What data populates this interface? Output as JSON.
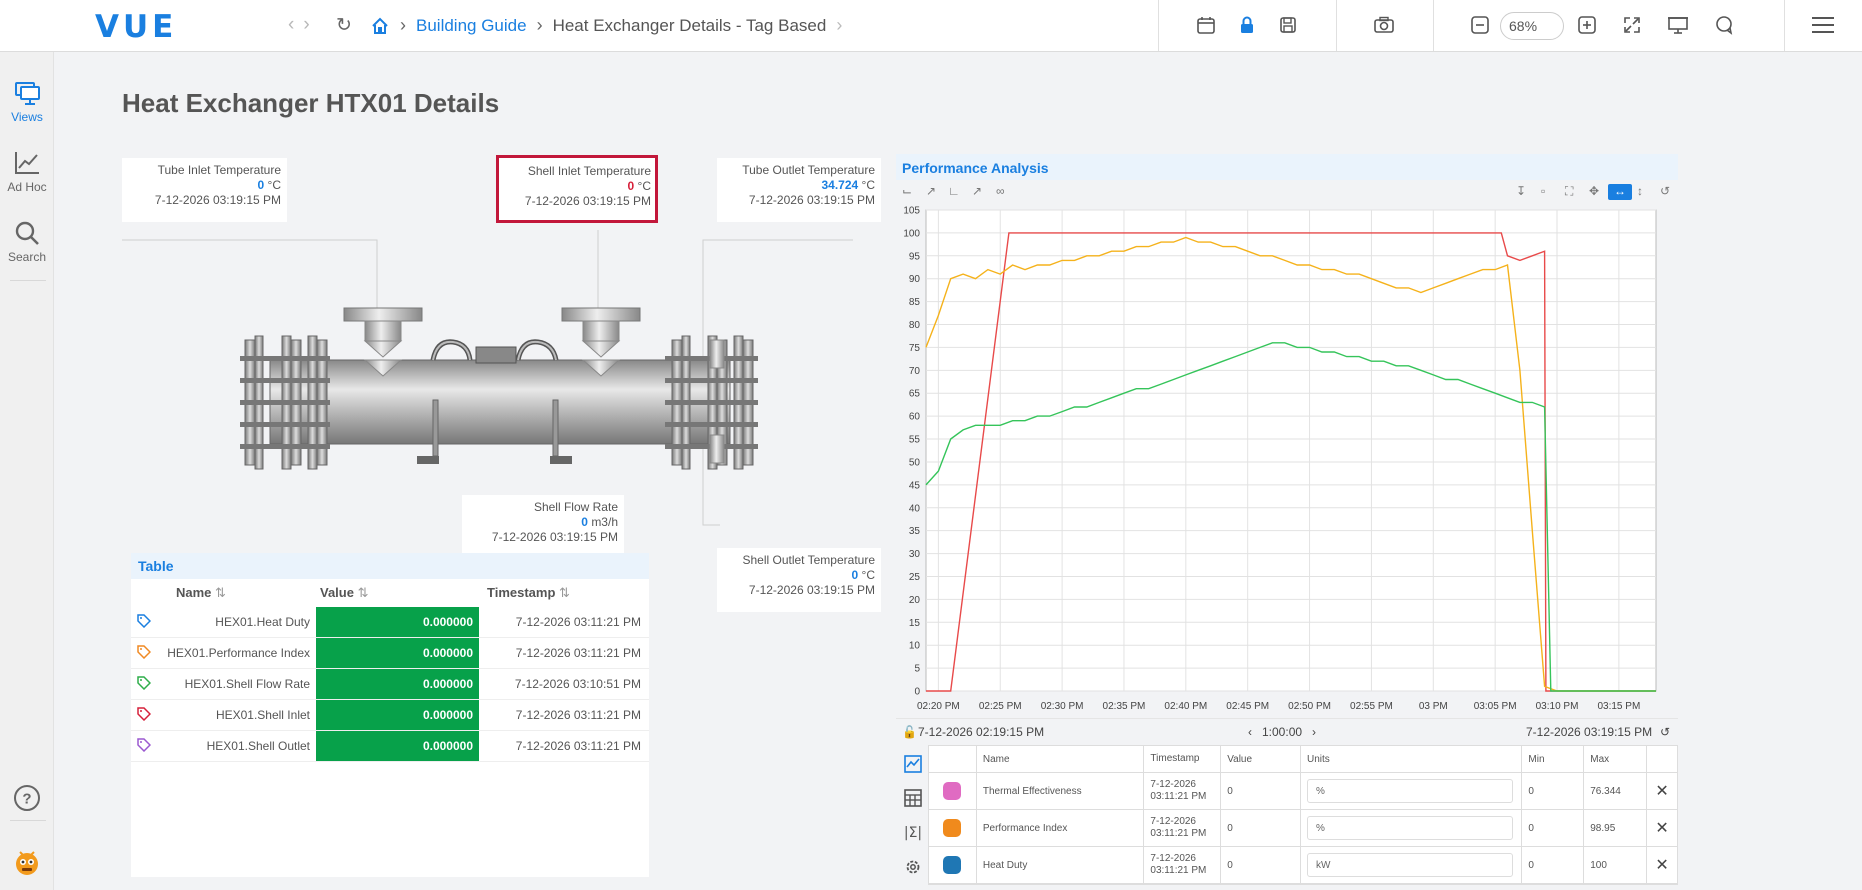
{
  "app": {
    "logo": "VUE"
  },
  "breadcrumb": {
    "items": [
      "Building Guide",
      "Heat Exchanger Details - Tag Based"
    ]
  },
  "toolbar": {
    "zoom": "68%"
  },
  "sidebar": {
    "items": [
      {
        "label": "Views",
        "icon": "views-icon"
      },
      {
        "label": "Ad Hoc",
        "icon": "chart-line-icon"
      },
      {
        "label": "Search",
        "icon": "search-icon"
      }
    ]
  },
  "page": {
    "title": "Heat Exchanger HTX01 Details"
  },
  "cards": {
    "tube_inlet": {
      "label": "Tube Inlet Temperature",
      "value": "0",
      "unit": "°C",
      "time": "7-12-2026 03:19:15 PM"
    },
    "shell_inlet": {
      "label": "Shell Inlet Temperature",
      "value": "0",
      "unit": "°C",
      "time": "7-12-2026 03:19:15 PM"
    },
    "tube_outlet": {
      "label": "Tube Outlet Temperature",
      "value": "34.724",
      "unit": "°C",
      "time": "7-12-2026 03:19:15 PM"
    },
    "shell_flow": {
      "label": "Shell Flow Rate",
      "value": "0",
      "unit": "m3/h",
      "time": "7-12-2026 03:19:15 PM"
    },
    "shell_outlet": {
      "label": "Shell Outlet Temperature",
      "value": "0",
      "unit": "°C",
      "time": "7-12-2026 03:19:15 PM"
    }
  },
  "table": {
    "title": "Table",
    "headers": {
      "name": "Name",
      "value": "Value",
      "timestamp": "Timestamp"
    },
    "rows": [
      {
        "name": "HEX01.Heat Duty",
        "value": "0.000000",
        "timestamp": "7-12-2026 03:11:21 PM",
        "color": "#1a7fe0"
      },
      {
        "name": "HEX01.Performance Index",
        "value": "0.000000",
        "timestamp": "7-12-2026 03:11:21 PM",
        "color": "#f08a24"
      },
      {
        "name": "HEX01.Shell Flow Rate",
        "value": "0.000000",
        "timestamp": "7-12-2026 03:10:51 PM",
        "color": "#2fae4a"
      },
      {
        "name": "HEX01.Shell Inlet",
        "value": "0.000000",
        "timestamp": "7-12-2026 03:11:21 PM",
        "color": "#d6213b"
      },
      {
        "name": "HEX01.Shell Outlet",
        "value": "0.000000",
        "timestamp": "7-12-2026 03:11:21 PM",
        "color": "#9b59d0"
      }
    ]
  },
  "chart_panel": {
    "title": "Performance Analysis",
    "start": "7-12-2026 02:19:15 PM",
    "end": "7-12-2026 03:19:15 PM",
    "duration": "1:00:00"
  },
  "legend": {
    "headers": {
      "name": "Name",
      "timestamp": "Timestamp",
      "value": "Value",
      "units": "Units",
      "min": "Min",
      "max": "Max"
    },
    "rows": [
      {
        "name": "Thermal Effectiveness",
        "ts1": "7-12-2026",
        "ts2": "03:11:21 PM",
        "value": "0",
        "units": "%",
        "min": "0",
        "max": "76.344",
        "color": "#e06bc2"
      },
      {
        "name": "Performance Index",
        "ts1": "7-12-2026",
        "ts2": "03:11:21 PM",
        "value": "0",
        "units": "%",
        "min": "0",
        "max": "98.95",
        "color": "#f08a1c"
      },
      {
        "name": "Heat Duty",
        "ts1": "7-12-2026",
        "ts2": "03:11:21 PM",
        "value": "0",
        "units": "kW",
        "min": "0",
        "max": "100",
        "color": "#1f77b4"
      }
    ]
  },
  "chart_data": {
    "type": "line",
    "x_ticks": [
      "02:20 PM",
      "02:25 PM",
      "02:30 PM",
      "02:35 PM",
      "02:40 PM",
      "02:45 PM",
      "02:50 PM",
      "02:55 PM",
      "03 PM",
      "03:05 PM",
      "03:10 PM",
      "03:15 PM"
    ],
    "x_range_minutes": [
      -1,
      58
    ],
    "ylim": [
      0,
      105
    ],
    "y_ticks": [
      0,
      5,
      10,
      15,
      20,
      25,
      30,
      35,
      40,
      45,
      50,
      55,
      60,
      65,
      70,
      75,
      80,
      85,
      90,
      95,
      100,
      105
    ],
    "grid": true,
    "series": [
      {
        "color": "#e84a4a",
        "points": [
          [
            -1,
            0
          ],
          [
            1,
            0
          ],
          [
            5.7,
            100
          ],
          [
            45.5,
            100
          ],
          [
            46,
            95
          ],
          [
            47,
            94
          ],
          [
            48,
            95
          ],
          [
            49,
            96
          ],
          [
            49.1,
            0
          ],
          [
            58,
            0
          ]
        ]
      },
      {
        "color": "#f5b21b",
        "points": [
          [
            -1,
            75
          ],
          [
            0,
            82
          ],
          [
            1,
            90
          ],
          [
            2,
            91
          ],
          [
            3,
            90
          ],
          [
            4,
            92
          ],
          [
            5,
            91
          ],
          [
            6,
            93
          ],
          [
            7,
            92
          ],
          [
            8,
            93
          ],
          [
            9,
            93
          ],
          [
            10,
            94
          ],
          [
            11,
            94
          ],
          [
            12,
            95
          ],
          [
            13,
            95
          ],
          [
            14,
            96
          ],
          [
            15,
            96
          ],
          [
            16,
            97
          ],
          [
            17,
            97
          ],
          [
            18,
            98
          ],
          [
            19,
            98
          ],
          [
            20,
            99
          ],
          [
            21,
            98
          ],
          [
            22,
            98
          ],
          [
            23,
            97
          ],
          [
            24,
            97
          ],
          [
            25,
            96
          ],
          [
            26,
            95
          ],
          [
            27,
            95
          ],
          [
            28,
            94
          ],
          [
            29,
            93
          ],
          [
            30,
            93
          ],
          [
            31,
            92
          ],
          [
            32,
            92
          ],
          [
            33,
            91
          ],
          [
            34,
            91
          ],
          [
            35,
            90
          ],
          [
            36,
            89
          ],
          [
            37,
            88
          ],
          [
            38,
            88
          ],
          [
            39,
            87
          ],
          [
            40,
            88
          ],
          [
            41,
            89
          ],
          [
            42,
            90
          ],
          [
            43,
            91
          ],
          [
            44,
            92
          ],
          [
            45,
            92
          ],
          [
            46,
            93
          ],
          [
            47,
            70
          ],
          [
            48,
            35
          ],
          [
            49,
            1
          ],
          [
            50,
            0
          ],
          [
            58,
            0
          ]
        ]
      },
      {
        "color": "#35c45a",
        "points": [
          [
            -1,
            45
          ],
          [
            0,
            48
          ],
          [
            1,
            55
          ],
          [
            2,
            57
          ],
          [
            3,
            58
          ],
          [
            4,
            58
          ],
          [
            5,
            58
          ],
          [
            6,
            59
          ],
          [
            7,
            59
          ],
          [
            8,
            60
          ],
          [
            9,
            60
          ],
          [
            10,
            61
          ],
          [
            11,
            62
          ],
          [
            12,
            62
          ],
          [
            13,
            63
          ],
          [
            14,
            64
          ],
          [
            15,
            65
          ],
          [
            16,
            66
          ],
          [
            17,
            66
          ],
          [
            18,
            67
          ],
          [
            19,
            68
          ],
          [
            20,
            69
          ],
          [
            21,
            70
          ],
          [
            22,
            71
          ],
          [
            23,
            72
          ],
          [
            24,
            73
          ],
          [
            25,
            74
          ],
          [
            26,
            75
          ],
          [
            27,
            76
          ],
          [
            28,
            76
          ],
          [
            29,
            75
          ],
          [
            30,
            75
          ],
          [
            31,
            74
          ],
          [
            32,
            74
          ],
          [
            33,
            73
          ],
          [
            34,
            73
          ],
          [
            35,
            72
          ],
          [
            36,
            72
          ],
          [
            37,
            71
          ],
          [
            38,
            71
          ],
          [
            39,
            70
          ],
          [
            40,
            69
          ],
          [
            41,
            68
          ],
          [
            42,
            68
          ],
          [
            43,
            67
          ],
          [
            44,
            66
          ],
          [
            45,
            65
          ],
          [
            46,
            64
          ],
          [
            47,
            63
          ],
          [
            48,
            63
          ],
          [
            49,
            62
          ],
          [
            49.5,
            0
          ],
          [
            58,
            0
          ]
        ]
      }
    ]
  }
}
